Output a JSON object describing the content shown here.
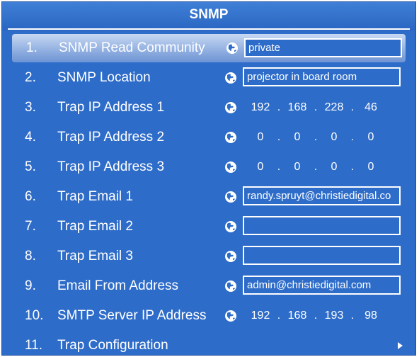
{
  "title": "SNMP",
  "rows": [
    {
      "num": "1.",
      "label": "SNMP Read Community",
      "type": "text",
      "value": "private",
      "selected": true
    },
    {
      "num": "2.",
      "label": "SNMP Location",
      "type": "text",
      "value": "projector in board room"
    },
    {
      "num": "3.",
      "label": "Trap IP Address 1",
      "type": "ip",
      "octets": [
        "192",
        "168",
        "228",
        "46"
      ]
    },
    {
      "num": "4.",
      "label": "Trap IP Address 2",
      "type": "ip",
      "octets": [
        "0",
        "0",
        "0",
        "0"
      ]
    },
    {
      "num": "5.",
      "label": "Trap IP Address 3",
      "type": "ip",
      "octets": [
        "0",
        "0",
        "0",
        "0"
      ]
    },
    {
      "num": "6.",
      "label": "Trap Email 1",
      "type": "text",
      "value": "randy.spruyt@christiedigital.co"
    },
    {
      "num": "7.",
      "label": "Trap Email 2",
      "type": "text",
      "value": ""
    },
    {
      "num": "8.",
      "label": "Trap Email 3",
      "type": "text",
      "value": ""
    },
    {
      "num": "9.",
      "label": "Email From Address",
      "type": "text",
      "value": "admin@christiedigital.com"
    },
    {
      "num": "10.",
      "label": "SMTP Server IP Address",
      "type": "ip",
      "octets": [
        "192",
        "168",
        "193",
        "98"
      ]
    },
    {
      "num": "11.",
      "label": "Trap Configuration",
      "type": "submenu",
      "icon": "chevron-right-icon"
    }
  ],
  "colors": {
    "panel": "#2e6cc9",
    "selected_highlight": "#8faee0",
    "text": "#ffffff"
  },
  "icons": {
    "network": "globe-icon",
    "submenu": "chevron-right-icon"
  }
}
